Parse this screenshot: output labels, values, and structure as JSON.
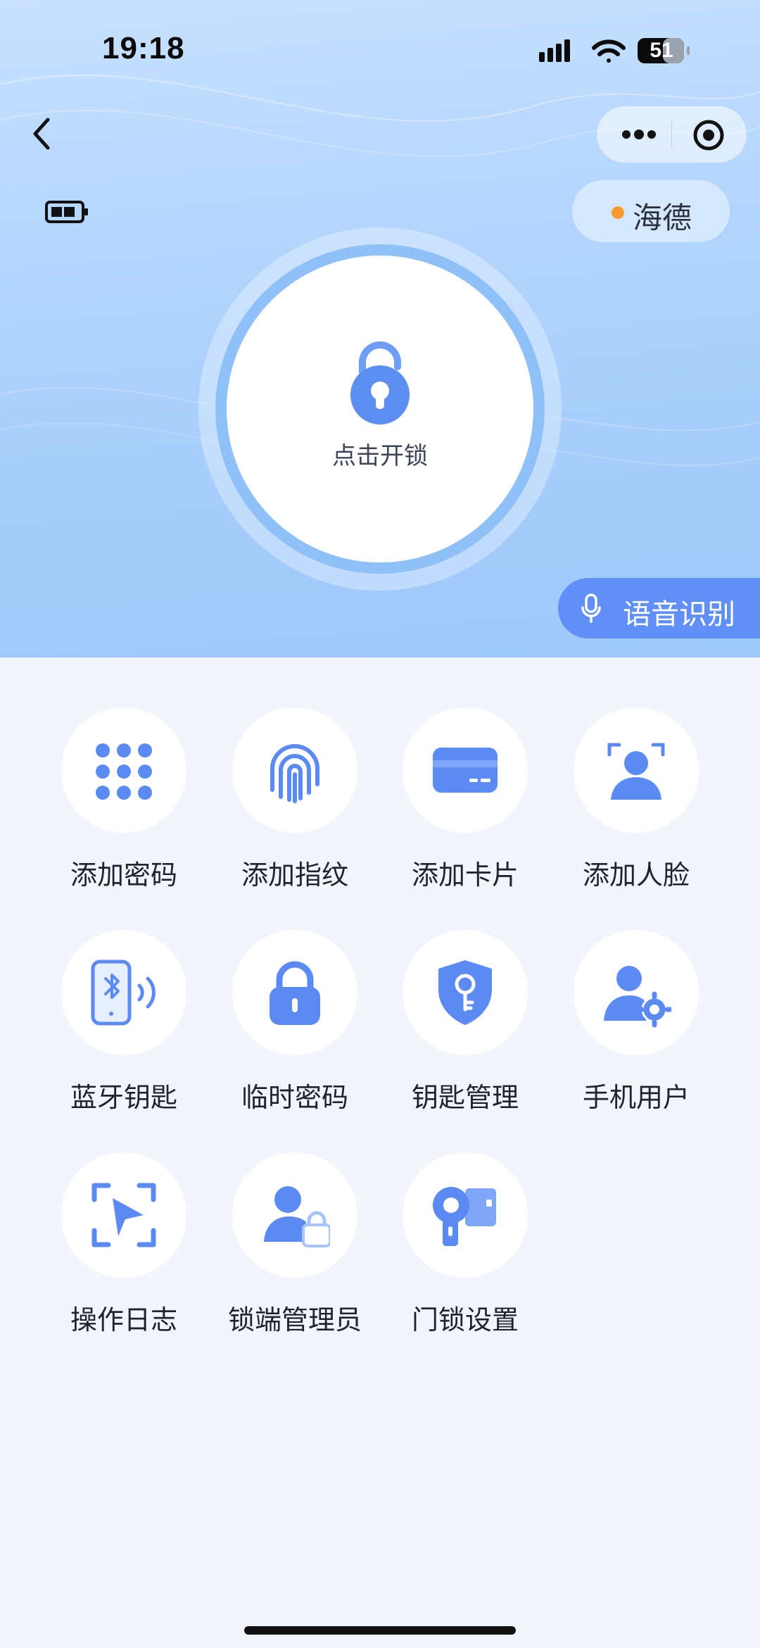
{
  "status_bar": {
    "time": "19:18",
    "battery_percent": "51"
  },
  "nav": {
    "back_icon": "chevron-left-icon",
    "more_icon": "more-dots-icon",
    "target_icon": "target-icon"
  },
  "device": {
    "battery_icon": "battery-icon",
    "name": "海德",
    "status_color": "#f99a2f"
  },
  "unlock": {
    "label": "点击开锁",
    "icon": "padlock-icon"
  },
  "voice": {
    "label": "语音识别",
    "icon": "microphone-icon"
  },
  "features": [
    {
      "label": "添加密码",
      "icon": "keypad-icon"
    },
    {
      "label": "添加指纹",
      "icon": "fingerprint-icon"
    },
    {
      "label": "添加卡片",
      "icon": "card-icon"
    },
    {
      "label": "添加人脸",
      "icon": "face-scan-icon"
    },
    {
      "label": "蓝牙钥匙",
      "icon": "bluetooth-key-icon"
    },
    {
      "label": "临时密码",
      "icon": "lock-icon"
    },
    {
      "label": "钥匙管理",
      "icon": "shield-key-icon"
    },
    {
      "label": "手机用户",
      "icon": "user-settings-icon"
    },
    {
      "label": "操作日志",
      "icon": "log-play-icon"
    },
    {
      "label": "锁端管理员",
      "icon": "user-lock-icon"
    },
    {
      "label": "门锁设置",
      "icon": "door-lock-settings-icon"
    }
  ],
  "colors": {
    "accent": "#5f8ff7",
    "hero": "#a6cdfb",
    "background": "#f3f5fd"
  }
}
